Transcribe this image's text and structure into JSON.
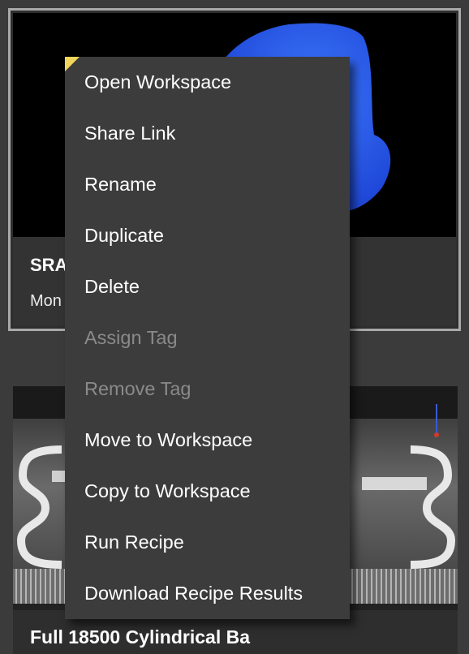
{
  "cards": [
    {
      "title": "SRA",
      "date": "Mon"
    },
    {
      "title": "Full 18500 Cylindrical Ba"
    }
  ],
  "context_menu": {
    "items": [
      {
        "label": "Open Workspace",
        "enabled": true
      },
      {
        "label": "Share Link",
        "enabled": true
      },
      {
        "label": "Rename",
        "enabled": true
      },
      {
        "label": "Duplicate",
        "enabled": true
      },
      {
        "label": "Delete",
        "enabled": true
      },
      {
        "label": "Assign Tag",
        "enabled": false
      },
      {
        "label": "Remove Tag",
        "enabled": false
      },
      {
        "label": "Move to Workspace",
        "enabled": true
      },
      {
        "label": "Copy to Workspace",
        "enabled": true
      },
      {
        "label": "Run Recipe",
        "enabled": true
      },
      {
        "label": "Download Recipe Results",
        "enabled": true
      }
    ]
  },
  "colors": {
    "page_bg": "#3b3b3b",
    "menu_bg": "#3c3c3c",
    "menu_text": "#ffffff",
    "menu_text_disabled": "#8a8a8a",
    "selected_border": "#a9a9a9",
    "corner_accent": "#f1d45a",
    "blue_render": "#2f6bff"
  }
}
